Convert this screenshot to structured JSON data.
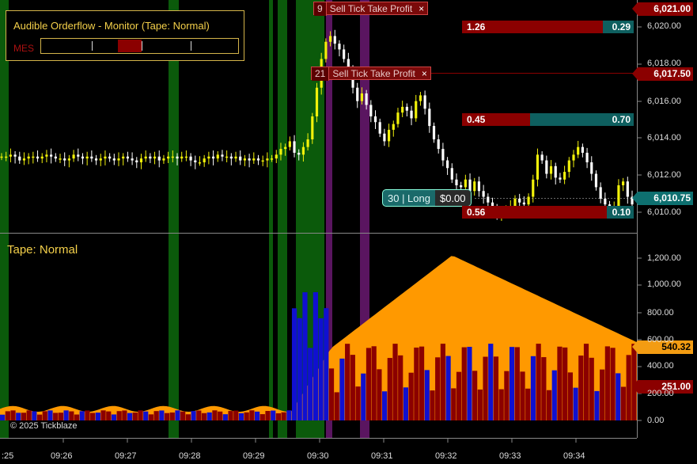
{
  "monitor": {
    "title": "Audible Orderflow - Monitor (Tape: Normal)",
    "symbol": "MES",
    "meter_fill_fraction": 0.13
  },
  "orders": [
    {
      "qty": "9",
      "label": "Sell Tick Take Profit",
      "close": "×"
    },
    {
      "qty": "21",
      "label": "Sell Tick Take Profit",
      "close": "×"
    }
  ],
  "position": {
    "qty_side": "30 | Long",
    "pnl": "$0.00"
  },
  "ratios": [
    {
      "left": "1.26",
      "right": "0.29"
    },
    {
      "left": "0.45",
      "right": "0.70"
    },
    {
      "left": "0.56",
      "right": "0.10"
    }
  ],
  "price_flags": [
    {
      "value": "6,021.00",
      "color": "#8b0000"
    },
    {
      "value": "6,017.50",
      "color": "#8b0000"
    },
    {
      "value": "6,010.75",
      "color": "#0e7070"
    }
  ],
  "price_axis": [
    "6,020.00",
    "6,018.00",
    "6,016.00",
    "6,014.00",
    "6,012.00",
    "6,010.00"
  ],
  "tape": {
    "label": "Tape: Normal",
    "flags": [
      {
        "value": "540.32",
        "color": "#f39c12",
        "text_color": "#000"
      },
      {
        "value": "251.00",
        "color": "#8b0000",
        "text_color": "#fff"
      }
    ],
    "axis": [
      "1,200.00",
      "1,000.00",
      "800.00",
      "600.00",
      "400.00",
      "200.00",
      "0.00"
    ]
  },
  "time_axis": [
    ":25",
    "09:26",
    "09:27",
    "09:28",
    "09:29",
    "09:30",
    "09:31",
    "09:32",
    "09:33",
    "09:34"
  ],
  "copyright": "© 2025 Tickblaze",
  "colors": {
    "up_candle": "#f2f20a",
    "down_candle": "#ffffff",
    "bid_volume": "#8b0000",
    "ask_volume": "#1010d0",
    "tape_area": "#ff9900",
    "green_band": "#0b5a0b",
    "purple_band": "#5a1560"
  },
  "chart_data": {
    "type": "candlestick",
    "ylim": [
      6009.5,
      6021.5
    ],
    "close_series_points": [
      6013.4,
      6013.4,
      6013.5,
      6013.4,
      6013.2,
      6013.3,
      6013.4,
      6013.4,
      6013.3,
      6013.4,
      6013.5,
      6013.4,
      6013.3,
      6013.3,
      6013.2,
      6013.3,
      6013.5,
      6013.4,
      6013.3,
      6013.4,
      6013.3,
      6013.2,
      6013.3,
      6013.4,
      6013.3,
      6013.2,
      6013.3,
      6013.4,
      6013.3,
      6013.2,
      6013.1,
      6013.3,
      6013.4,
      6013.3,
      6013.4,
      6013.2,
      6013.3,
      6013.4,
      6013.4,
      6013.3,
      6013.4,
      6013.4,
      6013.2,
      6013.1,
      6013.1,
      6013.3,
      6013.4,
      6013.3,
      6013.5,
      6013.4,
      6013.4,
      6013.3,
      6013.4,
      6013.2,
      6013.3,
      6013.2,
      6013.3,
      6013.2,
      6013.2,
      6013.3,
      6013.3,
      6013.5,
      6013.8,
      6013.9,
      6014.2,
      6013.6,
      6013.5,
      6013.9,
      6014.3,
      6015.5,
      6017.0,
      6018.5,
      6019.4,
      6019.7,
      6019.3,
      6019.0,
      6018.5,
      6018.0,
      6017.0,
      6016.3,
      6016.7,
      6016.1,
      6015.5,
      6015.2,
      6014.6,
      6014.2,
      6014.8,
      6015.1,
      6015.7,
      6016.0,
      6015.8,
      6015.4,
      6016.3,
      6016.6,
      6015.9,
      6015.0,
      6014.3,
      6013.8,
      6013.2,
      6012.8,
      6012.2,
      6011.9,
      6011.8,
      6012.2,
      6011.6,
      6012.1,
      6011.6,
      6011.3,
      6011.0,
      6010.6,
      6010.4,
      6010.4,
      6010.6,
      6010.8,
      6011.2,
      6011.0,
      6010.9,
      6011.3,
      6012.2,
      6013.5,
      6013.2,
      6012.5,
      6012.9,
      6012.3,
      6012.2,
      6012.6,
      6013.2,
      6013.5,
      6013.9,
      6013.6,
      6013.1,
      6012.5,
      6011.8,
      6011.2,
      6010.9,
      6010.6,
      6010.8,
      6011.9,
      6012.1,
      6011.3,
      6010.9
    ],
    "tape_series": {
      "orange_area_peak": 1140,
      "last_value": 540.32,
      "last_red_bar": 251.0
    }
  }
}
